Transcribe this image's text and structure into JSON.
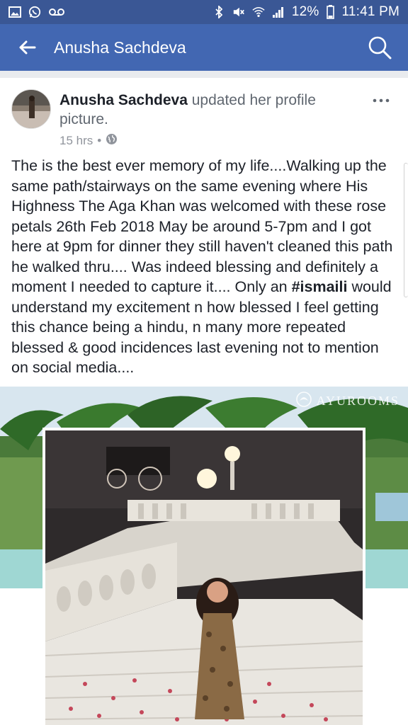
{
  "status_bar": {
    "battery": "12%",
    "time": "11:41 PM",
    "left_icons": [
      "gallery-icon",
      "whatsapp-icon",
      "voicemail-icon"
    ],
    "right_icons": [
      "bluetooth-icon",
      "mute-icon",
      "wifi-icon",
      "signal-icon",
      "battery-icon"
    ]
  },
  "app_bar": {
    "title": "Anusha Sachdeva",
    "bg_color": "#4267b2"
  },
  "post": {
    "author": "Anusha Sachdeva",
    "action": "updated her profile picture.",
    "time": "15 hrs",
    "separator": "•",
    "privacy_icon": "globe-icon",
    "text_before": "The is the best ever memory of my life....Walking up the same path/stairways on the same evening where His Highness The Aga Khan was welcomed with these rose petals 26th Feb 2018 May be around 5-7pm  and I got here at 9pm for dinner they still haven't cleaned this path he walked thru.... Was indeed blessing and definitely a moment I needed to capture it.... Only an ",
    "hashtag": "#ismaili",
    "text_after": " would understand my excitement n how blessed I feel getting this chance being a hindu, n many more repeated  blessed & good incidences last evening not to mention on social media....",
    "photo_watermark": "AYUROOMS"
  }
}
